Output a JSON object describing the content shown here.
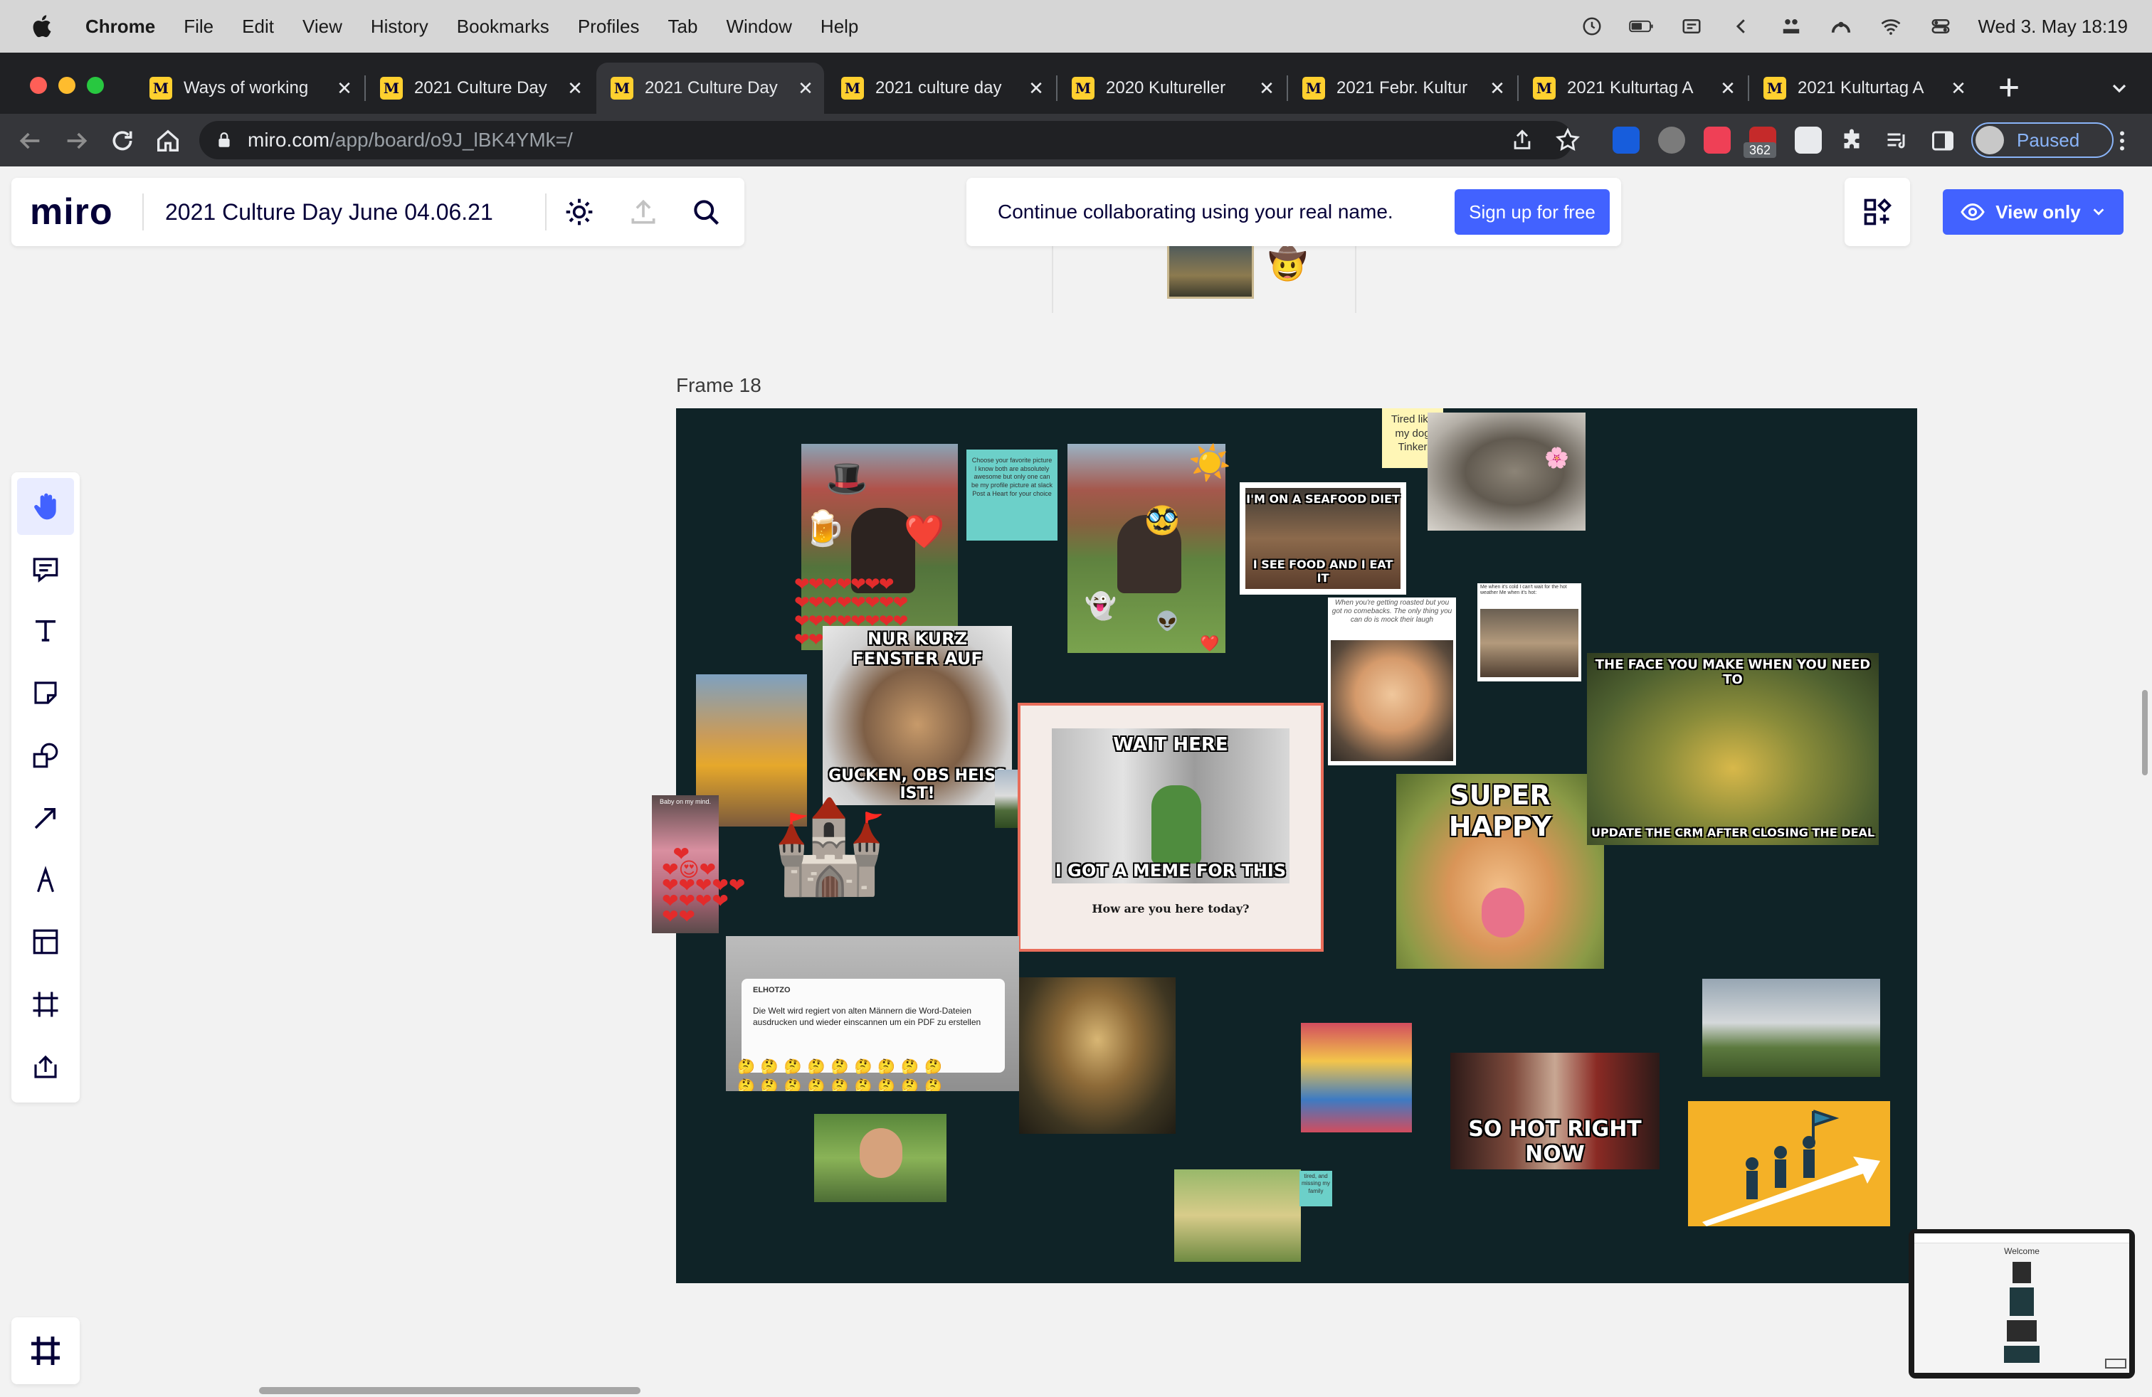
{
  "menubar": {
    "app_name": "Chrome",
    "items": [
      "File",
      "Edit",
      "View",
      "History",
      "Bookmarks",
      "Profiles",
      "Tab",
      "Window",
      "Help"
    ],
    "clock": "Wed 3. May  18:19"
  },
  "tabs": [
    {
      "title": "Ways of working"
    },
    {
      "title": "2021 Culture Day"
    },
    {
      "title": "2021 Culture Day"
    },
    {
      "title": "2021 culture day"
    },
    {
      "title": "2020 Kultureller"
    },
    {
      "title": "2021 Febr. Kultur"
    },
    {
      "title": "2021 Kulturtag A"
    },
    {
      "title": "2021 Kulturtag A"
    }
  ],
  "address_bar": {
    "host": "miro.com",
    "path": "/app/board/o9J_lBK4YMk=/",
    "extension_badge": "362",
    "profile_label": "Paused"
  },
  "miro": {
    "logo": "miro",
    "board_title": "2021 Culture Day June 04.06.21",
    "banner_text": "Continue collaborating using your real name.",
    "signup_label": "Sign up for free",
    "view_only_label": "View only"
  },
  "frame": {
    "label": "Frame 18",
    "sticky_notes": {
      "tired": "Tired like my dog Tinker",
      "choose": "Choose your favorite picture I know both are absolutely awesome but only one can be my profile picture at slack Post a Heart for your choice",
      "baby": "Baby on my mind.",
      "missing": "tired, and missing my family"
    },
    "memes": {
      "seafood_top": "I'M ON A SEAFOOD DIET",
      "seafood_bottom": "I SEE FOOD AND I EAT IT",
      "fenster_top": "NUR KURZ FENSTER AUF",
      "fenster_bottom": "GUCKEN, OBS HEISS IST!",
      "wait_top": "WAIT HERE",
      "wait_bottom": "I GOT A MEME FOR THIS",
      "wait_caption": "How are you here today?",
      "face_top": "THE FACE YOU MAKE WHEN YOU NEED TO",
      "face_bottom": "UPDATE THE CRM AFTER CLOSING THE DEAL",
      "super_happy": "SUPER HAPPY",
      "hot": "SO HOT RIGHT NOW",
      "roasted": "When you're getting roasted but you got no comebacks. The only thing you can do is mock their laugh",
      "cat_caption": "Me when it's cold I can't wait for the hot weather Me when it's hot:",
      "tweet_name": "ELHOTZO",
      "tweet_text": "Die Welt wird regiert von alten Männern die Word-Dateien ausdrucken und wieder einscannen um ein PDF zu erstellen"
    }
  },
  "minimap": {
    "title": "Welcome"
  },
  "colors": {
    "miro_blue": "#4262ff",
    "frame_bg": "#0f2327",
    "tab_strip": "#202124",
    "toolbar": "#35363a"
  }
}
